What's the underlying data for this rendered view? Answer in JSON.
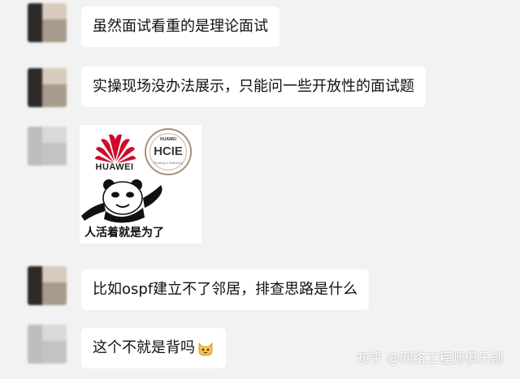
{
  "messages": [
    {
      "type": "text",
      "text": "虽然面试看重的是理论面试"
    },
    {
      "type": "text",
      "text": "实操现场没办法展示，只能问一些开放性的面试题"
    },
    {
      "type": "image",
      "brand_text": "HUAWEI",
      "badge_top": "HUAWEI",
      "badge_text": "HCIE",
      "badge_sub": "Routing & Switching",
      "caption": "人活着就是为了"
    },
    {
      "type": "text",
      "text": "比如ospf建立不了邻居，排查思路是什么"
    },
    {
      "type": "text",
      "text": "这个不就是背吗",
      "emoji": "cat-face-icon"
    }
  ],
  "watermark": "知乎 @网络工程师俱乐部",
  "colors": {
    "background": "#f2f2f2",
    "bubble": "#ffffff",
    "huawei_red": "#cf0a2c"
  }
}
